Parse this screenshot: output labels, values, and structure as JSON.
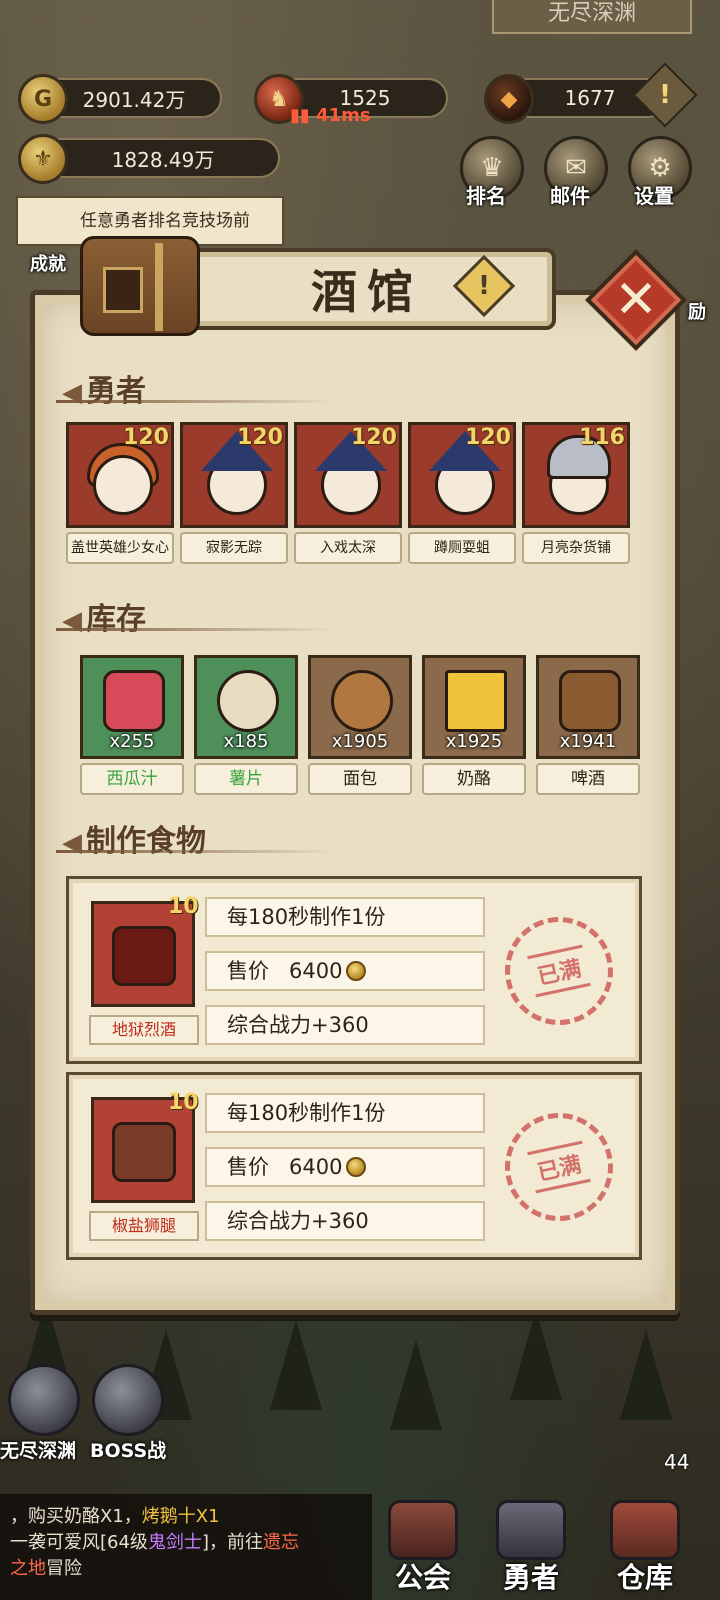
{
  "hud": {
    "top_banner": "无尽深渊",
    "gold": "2901.42万",
    "trophy": "1525",
    "ping": "41ms",
    "gems": "1677",
    "power": "1828.49万",
    "quest_text": "任意勇者排名竞技场前",
    "achievement_label": "成就",
    "rank_label": "排名",
    "mail_label": "邮件",
    "settings_label": "设置",
    "reward_label": "励"
  },
  "panel": {
    "title": "酒馆",
    "close_symbol": "✕",
    "warn_symbol": "!",
    "sections": {
      "heroes": "勇者",
      "inventory": "库存",
      "crafting": "制作食物"
    }
  },
  "heroes": [
    {
      "name": "盖世英雄少女心",
      "level": "120"
    },
    {
      "name": "寂影无踪",
      "level": "120"
    },
    {
      "name": "入戏太深",
      "level": "120"
    },
    {
      "name": "蹲厕耍蛆",
      "level": "120"
    },
    {
      "name": "月亮杂货铺",
      "level": "116"
    }
  ],
  "inventory": [
    {
      "name": "西瓜汁",
      "count": "x255"
    },
    {
      "name": "薯片",
      "count": "x185"
    },
    {
      "name": "面包",
      "count": "x1905"
    },
    {
      "name": "奶酪",
      "count": "x1925"
    },
    {
      "name": "啤酒",
      "count": "x1941"
    }
  ],
  "foods": [
    {
      "name": "地狱烈酒",
      "level": "10",
      "production": "每180秒制作1份",
      "price_label": "售价",
      "price": "6400",
      "power": "综合战力+360",
      "stamp": "已满"
    },
    {
      "name": "椒盐狮腿",
      "level": "10",
      "production": "每180秒制作1份",
      "price_label": "售价",
      "price": "6400",
      "power": "综合战力+360",
      "stamp": "已满"
    }
  ],
  "chat": {
    "line1_a": "，购买奶酪X1，",
    "line1_b": "烤鹅十X1",
    "line2_a": "一袭可爱风[64级",
    "line2_b": "鬼剑士",
    "line2_c": "]，前往",
    "line2_d": "遗忘",
    "line3_a": "之地",
    "line3_b": "冒险"
  },
  "bottom_nav": {
    "endless_abyss": "无尽深渊",
    "boss_battle": "BOSS战",
    "guild": "公会",
    "heroes": "勇者",
    "warehouse": "仓库",
    "warehouse_badge": "44"
  },
  "colors": {
    "panel_bg": "#e9dfc5",
    "panel_border": "#4a3b26",
    "hero_frame": "#9a3b2c",
    "item_green": "#4f8f5a",
    "stamp_red": "#c84b47",
    "food_name_red": "#c02a1a"
  }
}
